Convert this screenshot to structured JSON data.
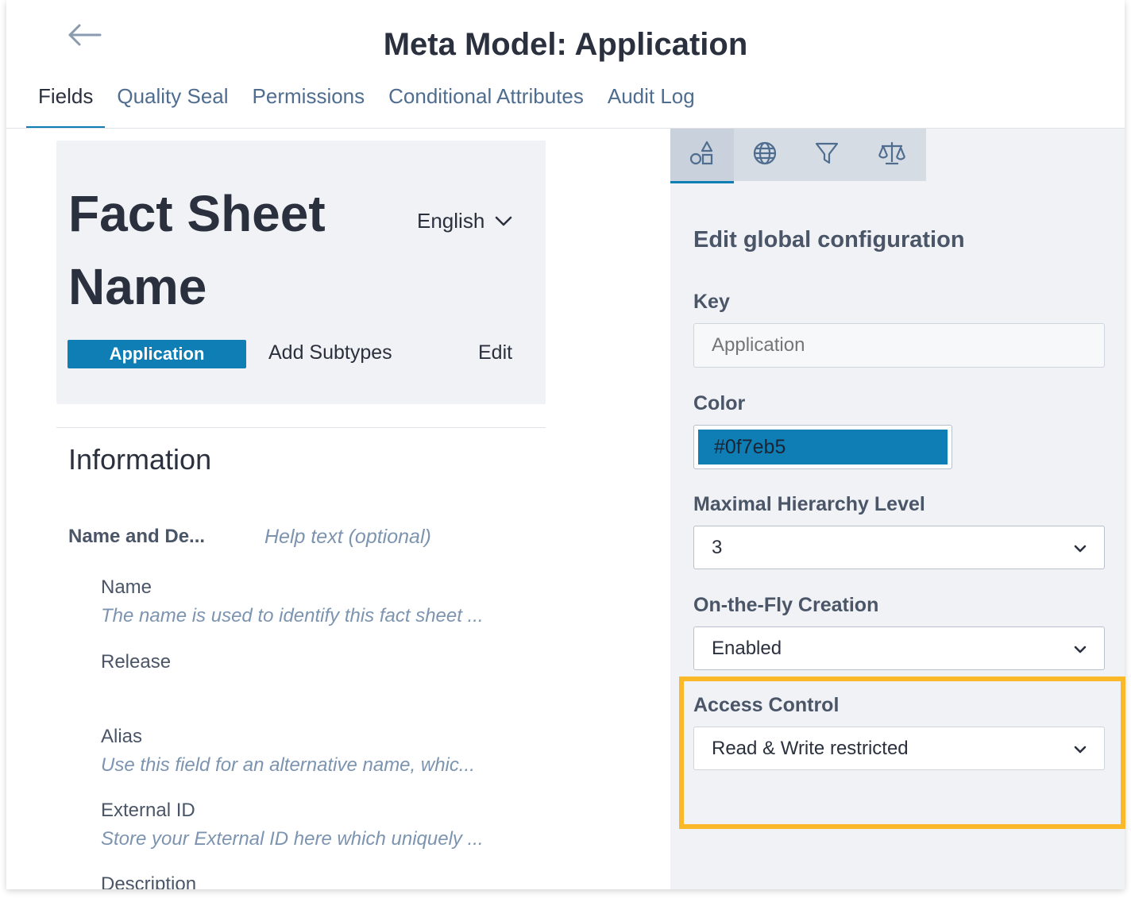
{
  "header": {
    "title": "Meta Model: Application",
    "tabs": [
      {
        "label": "Fields",
        "active": true
      },
      {
        "label": "Quality Seal",
        "active": false
      },
      {
        "label": "Permissions",
        "active": false
      },
      {
        "label": "Conditional Attributes",
        "active": false
      },
      {
        "label": "Audit Log",
        "active": false
      }
    ]
  },
  "fact_sheet": {
    "title": "Fact Sheet Name",
    "language": "English",
    "type_badge": "Application",
    "add_subtypes": "Add Subtypes",
    "edit": "Edit"
  },
  "information": {
    "title": "Information",
    "section_name": "Name and De...",
    "section_help": "Help text (optional)",
    "fields": [
      {
        "name": "Name",
        "description": "The name is used to identify this fact sheet ..."
      },
      {
        "name": "Release",
        "description": ""
      },
      {
        "name": "Alias",
        "description": "Use this field for an alternative name, whic..."
      },
      {
        "name": "External ID",
        "description": "Store your External ID here which uniquely ..."
      },
      {
        "name": "Description",
        "description": ""
      }
    ]
  },
  "panel": {
    "icon_tabs": [
      {
        "icon": "shapes-icon",
        "active": true
      },
      {
        "icon": "globe-icon",
        "active": false
      },
      {
        "icon": "filter-icon",
        "active": false
      },
      {
        "icon": "scale-icon",
        "active": false
      }
    ],
    "heading": "Edit global configuration",
    "key_label": "Key",
    "key_placeholder": "Application",
    "color_label": "Color",
    "color_value": "#0f7eb5",
    "hierarchy_label": "Maximal Hierarchy Level",
    "hierarchy_value": "3",
    "otf_label": "On-the-Fly Creation",
    "otf_value": "Enabled",
    "access_label": "Access Control",
    "access_value": "Read & Write restricted"
  },
  "colors": {
    "accent": "#0f7eb5",
    "highlight": "#fbb829",
    "text_dark": "#2a303d",
    "text_link": "#4f6d8f"
  }
}
